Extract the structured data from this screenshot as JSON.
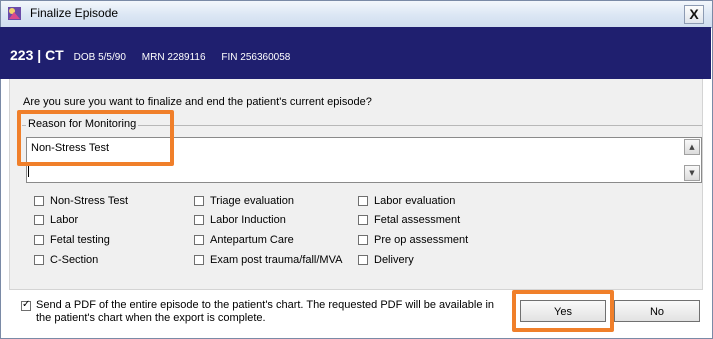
{
  "window": {
    "title": "Finalize Episode",
    "close_label": "X"
  },
  "banner": {
    "bed": "223",
    "separator": "|",
    "initials": "CT",
    "dob_label": "DOB 5/5/90",
    "mrn_label": "MRN 2289116",
    "fin_label": "FIN 256360058"
  },
  "question": "Are you sure you want to finalize and end the patient's current episode?",
  "reason": {
    "label": "Reason for Monitoring",
    "value": "Non-Stress Test"
  },
  "checkboxes": {
    "col1": [
      "Non-Stress Test",
      "Labor",
      "Fetal testing",
      "C-Section"
    ],
    "col2": [
      "Triage evaluation",
      "Labor Induction",
      "Antepartum Care",
      "Exam post trauma/fall/MVA"
    ],
    "col3": [
      "Labor evaluation",
      "Fetal assessment",
      "Pre op assessment",
      "Delivery"
    ]
  },
  "send_pdf": {
    "checked": true,
    "text": "Send a PDF of the entire episode to the patient's chart. The requested PDF will be available in the patient's chart when the export is complete."
  },
  "buttons": {
    "yes": "Yes",
    "no": "No"
  },
  "colors": {
    "banner": "#1f1f6f",
    "highlight": "#f07f2a"
  }
}
